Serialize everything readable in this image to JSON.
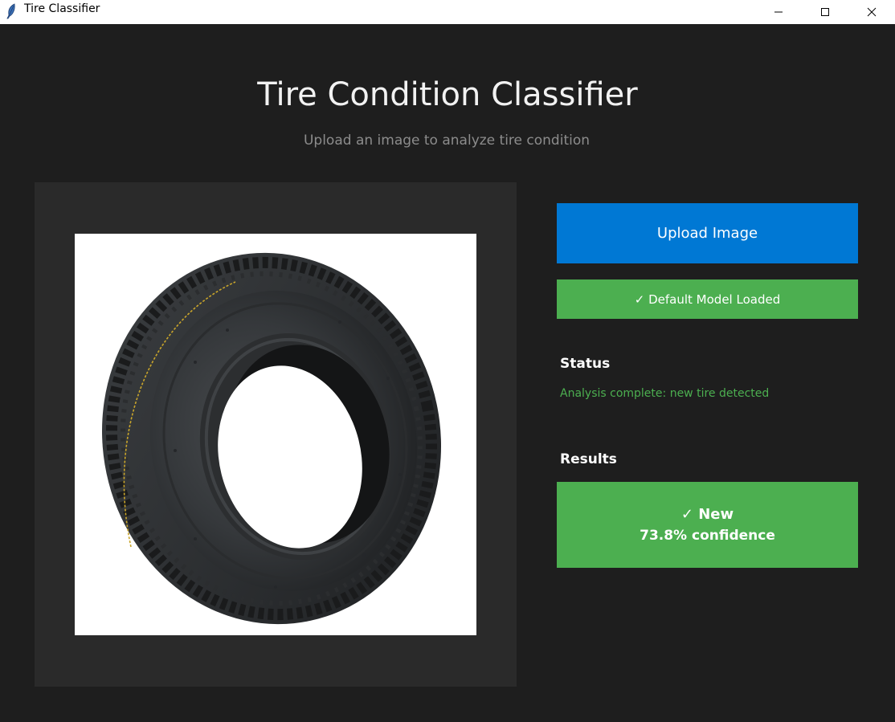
{
  "window": {
    "title": "Tire Classifier",
    "controls": {
      "minimize": "minimize-icon",
      "maximize": "maximize-icon",
      "close": "close-icon"
    }
  },
  "header": {
    "title": "Tire Condition Classifier",
    "subtitle": "Upload an image to analyze tire condition"
  },
  "image_panel": {
    "image": "tire-photo"
  },
  "actions": {
    "upload_label": "Upload Image",
    "model_status": "✓ Default Model Loaded"
  },
  "status": {
    "heading": "Status",
    "message": "Analysis complete: new tire detected"
  },
  "results": {
    "heading": "Results",
    "label": "✓ New",
    "confidence": "73.8% confidence"
  },
  "colors": {
    "background": "#1e1e1e",
    "panel": "#2a2a2a",
    "primary": "#0078d4",
    "success": "#4caf50",
    "muted_text": "#8c8c8c"
  }
}
